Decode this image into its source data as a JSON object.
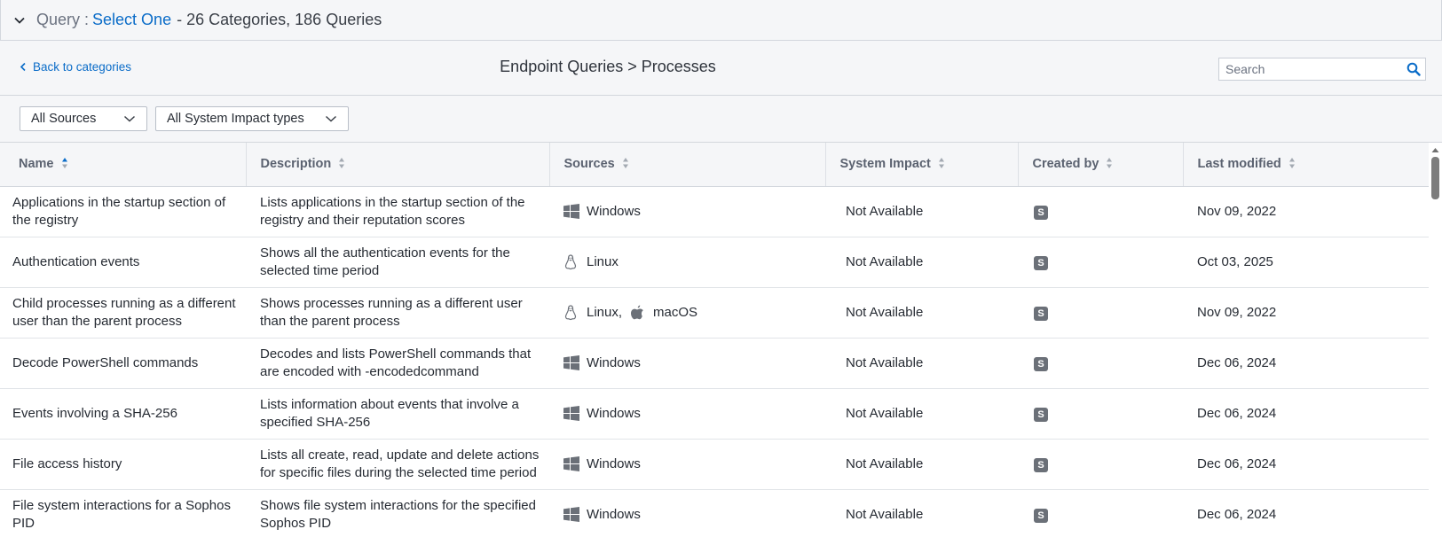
{
  "query_bar": {
    "prefix": "Query :",
    "selected": "Select One",
    "summary": "- 26 Categories, 186 Queries"
  },
  "header": {
    "back_label": "Back to categories",
    "breadcrumb": "Endpoint Queries > Processes",
    "search_placeholder": "Search"
  },
  "filters": {
    "sources": "All Sources",
    "impact": "All System Impact types"
  },
  "columns": [
    "Name",
    "Description",
    "Sources",
    "System Impact",
    "Created by",
    "Last modified"
  ],
  "rows": [
    {
      "name": "Applications in the startup section of the registry",
      "description": "Lists applications in the startup section of the registry and their reputation scores",
      "sources": [
        {
          "os": "Windows",
          "icon": "windows-icon"
        }
      ],
      "impact": "Not Available",
      "created_by": "S",
      "modified": "Nov 09, 2022"
    },
    {
      "name": "Authentication events",
      "description": "Shows all the authentication events for the selected time period",
      "sources": [
        {
          "os": "Linux",
          "icon": "linux-icon"
        }
      ],
      "impact": "Not Available",
      "created_by": "S",
      "modified": "Oct 03, 2025"
    },
    {
      "name": "Child processes running as a different user than the parent process",
      "description": "Shows processes running as a different user than the parent process",
      "sources": [
        {
          "os": "Linux",
          "icon": "linux-icon"
        },
        {
          "os": "macOS",
          "icon": "apple-icon"
        }
      ],
      "impact": "Not Available",
      "created_by": "S",
      "modified": "Nov 09, 2022"
    },
    {
      "name": "Decode PowerShell commands",
      "description": "Decodes and lists PowerShell commands that are encoded with -encodedcommand",
      "sources": [
        {
          "os": "Windows",
          "icon": "windows-icon"
        }
      ],
      "impact": "Not Available",
      "created_by": "S",
      "modified": "Dec 06, 2024"
    },
    {
      "name": "Events involving a SHA-256",
      "description": "Lists information about events that involve a specified SHA-256",
      "sources": [
        {
          "os": "Windows",
          "icon": "windows-icon"
        }
      ],
      "impact": "Not Available",
      "created_by": "S",
      "modified": "Dec 06, 2024"
    },
    {
      "name": "File access history",
      "description": "Lists all create, read, update and delete actions for specific files during the selected time period",
      "sources": [
        {
          "os": "Windows",
          "icon": "windows-icon"
        }
      ],
      "impact": "Not Available",
      "created_by": "S",
      "modified": "Dec 06, 2024"
    },
    {
      "name": "File system interactions for a Sophos PID",
      "description": "Shows file system interactions for the specified Sophos PID",
      "sources": [
        {
          "os": "Windows",
          "icon": "windows-icon"
        }
      ],
      "impact": "Not Available",
      "created_by": "S",
      "modified": "Dec 06, 2024"
    }
  ],
  "sort": {
    "column": "Name",
    "direction": "ascending"
  },
  "colors": {
    "link": "#0a6cc8",
    "header_bg": "#f5f6f8",
    "badge": "#6b7078"
  }
}
